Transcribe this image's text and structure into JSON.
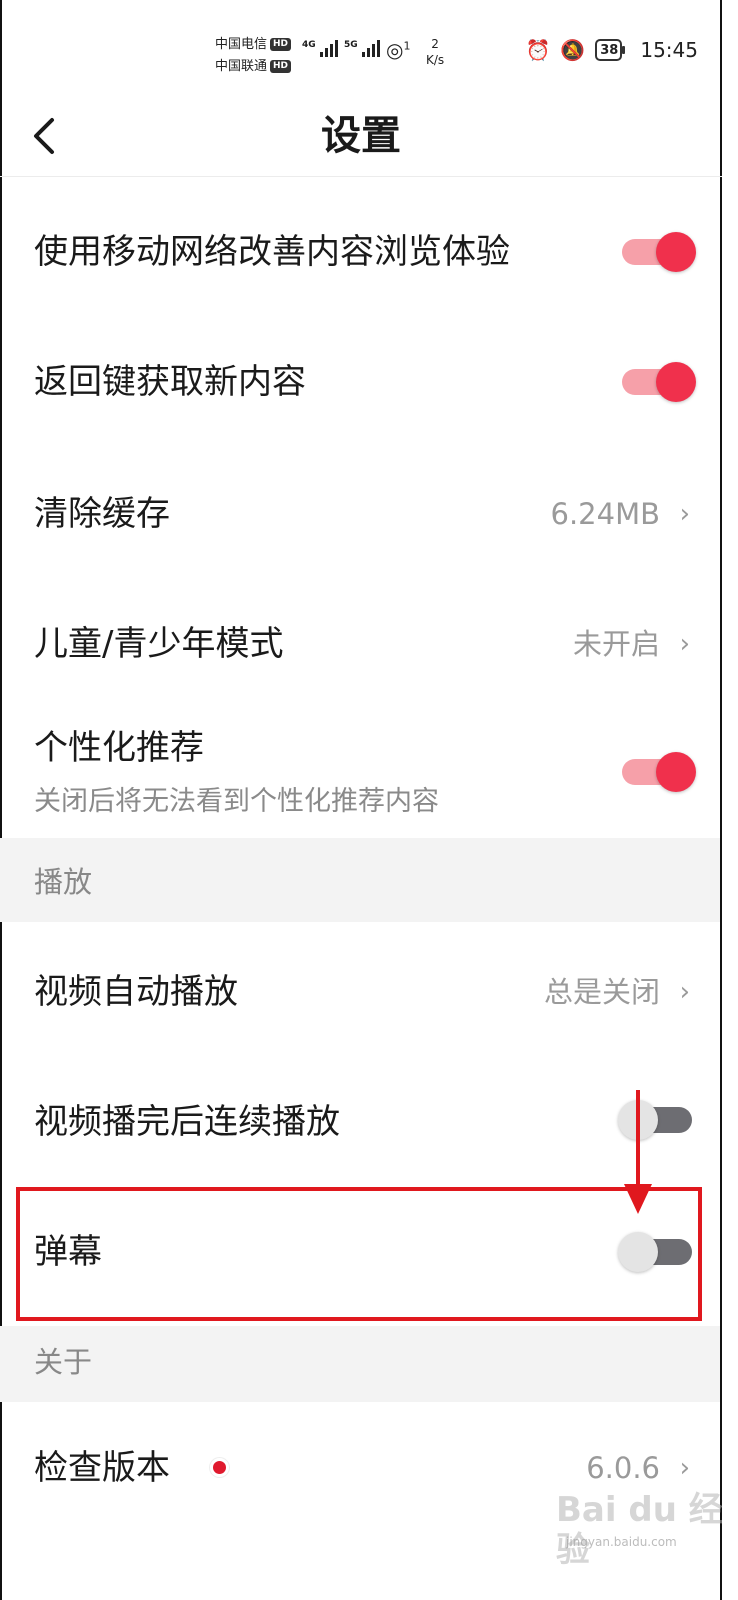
{
  "status_bar": {
    "carrier1": "中国电信",
    "carrier2": "中国联通",
    "hd_badge": "HD",
    "net1": "4G",
    "net2": "5G",
    "hotspot_count": "1",
    "speed_value": "2",
    "speed_unit": "K/s",
    "battery": "38",
    "time": "15:45"
  },
  "header": {
    "title": "设置",
    "back_icon": "chevron-left-icon"
  },
  "settings": {
    "mobile_network": {
      "label": "使用移动网络改善内容浏览体验",
      "enabled": true
    },
    "back_refresh": {
      "label": "返回键获取新内容",
      "enabled": true
    },
    "clear_cache": {
      "label": "清除缓存",
      "value": "6.24MB"
    },
    "kids_mode": {
      "label": "儿童/青少年模式",
      "value": "未开启"
    },
    "personalized": {
      "label": "个性化推荐",
      "subtitle": "关闭后将无法看到个性化推荐内容",
      "enabled": true
    }
  },
  "sections": {
    "playback": "播放",
    "about": "关于"
  },
  "playback": {
    "autoplay": {
      "label": "视频自动播放",
      "value": "总是关闭"
    },
    "continuous": {
      "label": "视频播完后连续播放",
      "enabled": false
    },
    "danmaku": {
      "label": "弹幕",
      "enabled": false
    }
  },
  "about": {
    "check_version": {
      "label": "检查版本",
      "value": "6.0.6"
    }
  },
  "chevron": "›",
  "colors": {
    "accent": "#f0304c",
    "annotation": "#e0181e",
    "section_bg": "#f3f3f3"
  },
  "watermark": "Bai du 经验",
  "watermark_sub": "jingyan.baidu.com"
}
